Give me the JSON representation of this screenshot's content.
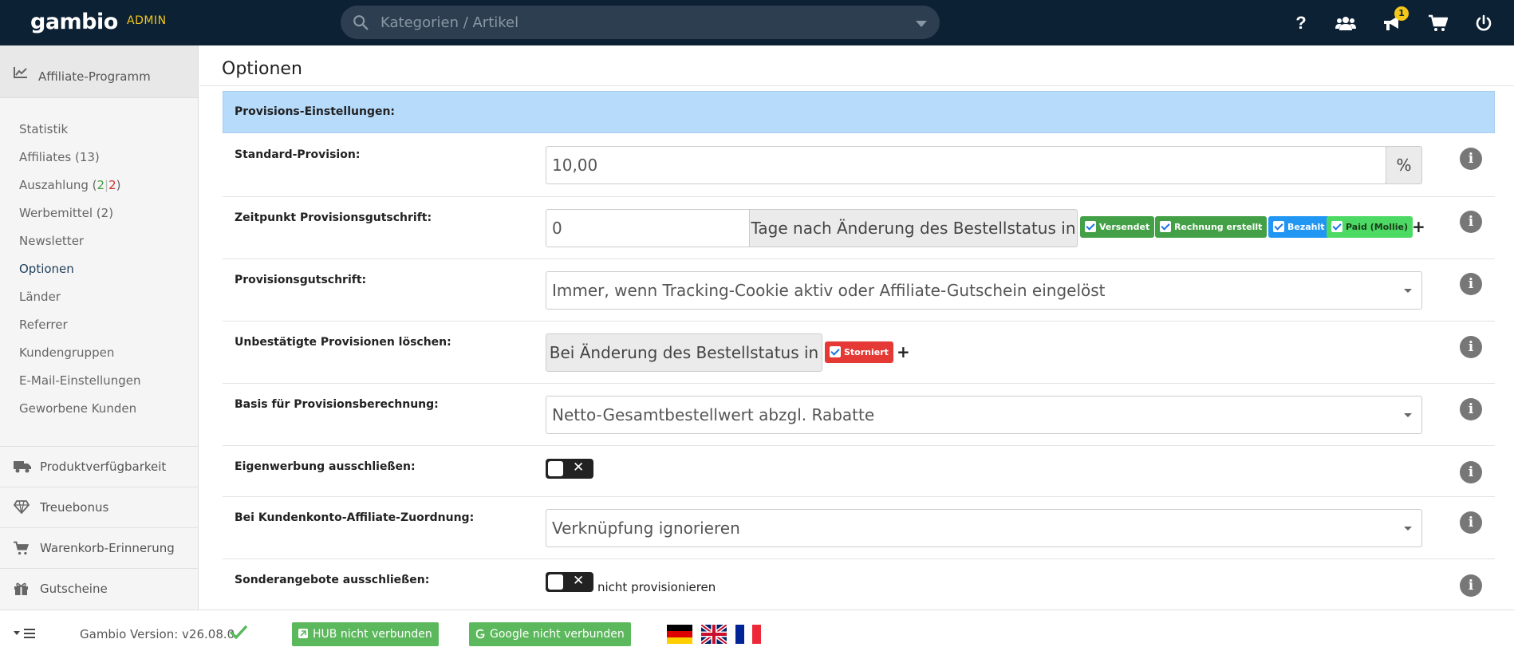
{
  "topbar": {
    "logo": "gambio",
    "admin_label": "ADMIN",
    "search_placeholder": "Kategorien / Artikel",
    "notification_count": "1",
    "icons": [
      "help-icon",
      "users-icon",
      "megaphone-icon",
      "cart-icon",
      "power-icon"
    ]
  },
  "sidebar": {
    "header": "Affiliate-Programm",
    "items": [
      {
        "label": "Statistik"
      },
      {
        "label": "Affiliates (13)"
      },
      {
        "label_prefix": "Auszahlung (",
        "green": "2",
        "sep": "|",
        "red": "2",
        "label_suffix": ")"
      },
      {
        "label": "Werbemittel (2)"
      },
      {
        "label": "Newsletter"
      },
      {
        "label": "Optionen",
        "active": true
      },
      {
        "label": "Länder"
      },
      {
        "label": "Referrer"
      },
      {
        "label": "Kundengruppen"
      },
      {
        "label": "E-Mail-Einstellungen"
      },
      {
        "label": "Geworbene Kunden"
      }
    ],
    "groups": [
      {
        "label": "Produktverfügbarkeit",
        "icon": "truck-icon"
      },
      {
        "label": "Treuebonus",
        "icon": "diamond-icon"
      },
      {
        "label": "Warenkorb-Erinnerung",
        "icon": "cart-icon"
      },
      {
        "label": "Gutscheine",
        "icon": "gift-icon"
      }
    ]
  },
  "main": {
    "title": "Optionen",
    "section": "Provisions-Einstellungen:",
    "rows": {
      "standard_provision": {
        "label": "Standard-Provision:",
        "value": "10,00",
        "unit": "%"
      },
      "zeitpunkt": {
        "label": "Zeitpunkt Provisionsgutschrift:",
        "value": "0",
        "addon": "Tage nach Änderung des Bestellstatus in",
        "chips": [
          {
            "label": "Versendet",
            "color": "#43a047"
          },
          {
            "label": "Rechnung erstellt",
            "color": "#43a047"
          },
          {
            "label": "Bezahlt",
            "color": "#2196f3"
          },
          {
            "label": "Paid (Mollie)",
            "color": "#4cd964"
          }
        ],
        "plus": "+"
      },
      "gutschrift": {
        "label": "Provisionsgutschrift:",
        "value": "Immer, wenn Tracking-Cookie aktiv oder Affiliate-Gutschein eingelöst"
      },
      "unbestaetigt": {
        "label": "Unbestätigte Provisionen löschen:",
        "addon": "Bei Änderung des Bestellstatus in",
        "chip": {
          "label": "Storniert",
          "color": "#e53935"
        },
        "plus": "+"
      },
      "basis": {
        "label": "Basis für Provisionsberechnung:",
        "value": "Netto-Gesamtbestellwert abzgl. Rabatte"
      },
      "eigenwerbung": {
        "label": "Eigenwerbung ausschließen:",
        "enabled": false
      },
      "kundenkonto": {
        "label": "Bei Kundenkonto-Affiliate-Zuordnung:",
        "value": "Verknüpfung ignorieren"
      },
      "sonderangebote": {
        "label": "Sonderangebote ausschließen:",
        "enabled": false,
        "after": "nicht provisionieren"
      }
    },
    "info_glyph": "i"
  },
  "footer": {
    "version": "Gambio Version: v26.08.0",
    "hub_button": "HUB nicht verbunden",
    "google_button": "Google nicht verbunden",
    "flags": [
      "german-flag",
      "uk-flag",
      "french-flag"
    ]
  },
  "colors": {
    "topbar": "#0c2134",
    "accent_yellow": "#f5c71a",
    "section_blue": "#b6dbfb",
    "button_green": "#5cb85c"
  }
}
